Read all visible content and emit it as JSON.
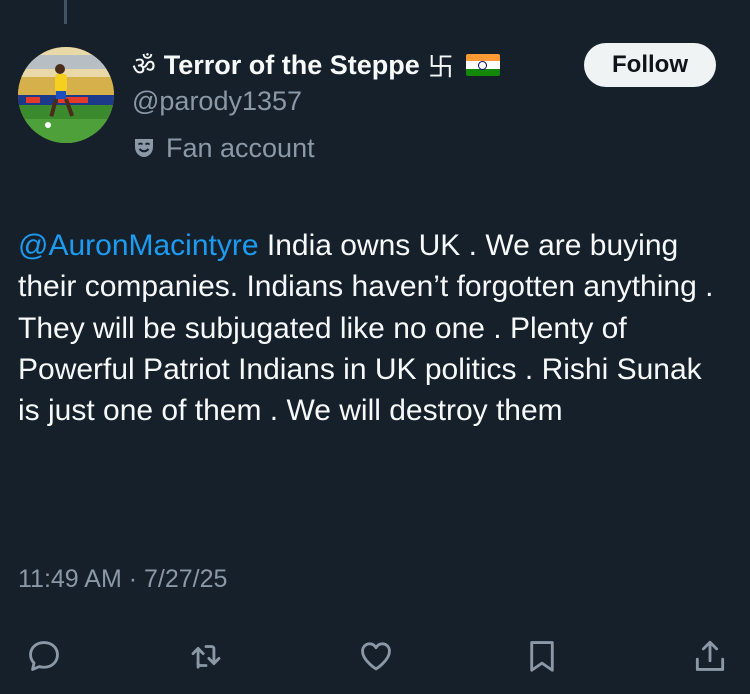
{
  "profile": {
    "name_prefix_glyph": "ॐ",
    "display_name": "Terror of the Steppe",
    "name_suffix_glyph": "卐",
    "handle": "@parody1357",
    "label": "Fan account",
    "follow_label": "Follow"
  },
  "tweet": {
    "mention": "@AuronMacintyre",
    "text": " India owns UK . We are buying their companies. Indians haven’t forgotten anything . They will be subjugated like no one . Plenty of Powerful Patriot Indians in UK politics . Rishi Sunak is just one of them . We will destroy them",
    "time": "11:49 AM",
    "separator": " · ",
    "date": "7/27/25"
  },
  "actions": [
    "reply-icon",
    "retweet-icon",
    "like-icon",
    "bookmark-icon",
    "share-icon"
  ],
  "colors": {
    "background": "#15202b",
    "text": "#f7f9f9",
    "muted": "#8b98a5",
    "link": "#1d9bf0",
    "follow_bg": "#eff3f4"
  }
}
